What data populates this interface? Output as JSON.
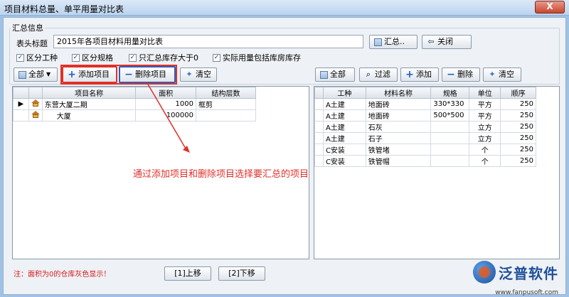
{
  "window": {
    "title": "项目材料总量、单平用量对比表",
    "close_label": "X"
  },
  "summary": {
    "group_label": "汇总信息",
    "header_label": "表头标题",
    "header_value": "2015年各项目材料用量对比表",
    "summarize_button": "汇总..",
    "close_button": "关闭",
    "checkboxes": [
      {
        "label": "区分工种",
        "checked": true
      },
      {
        "label": "区分规格",
        "checked": true
      },
      {
        "label": "只汇总库存大于0",
        "checked": true
      },
      {
        "label": "实际用量包括库房库存",
        "checked": true
      }
    ]
  },
  "left_toolbar": {
    "all": "全部",
    "add": "添加项目",
    "remove": "删除项目",
    "clear": "清空"
  },
  "right_toolbar": {
    "all": "全部",
    "filter": "过滤",
    "add": "添加",
    "remove": "删除",
    "clear": "清空"
  },
  "projects": {
    "columns": [
      "项目名称",
      "面积",
      "结构层数"
    ],
    "rows": [
      {
        "name": "东营大厦二期",
        "area": "1000",
        "structure": "框剪",
        "selected": true
      },
      {
        "name": "大厦",
        "area": "100000",
        "structure": "",
        "selected": false
      }
    ]
  },
  "materials": {
    "columns": [
      "工种",
      "材料名称",
      "规格",
      "单位",
      "顺序"
    ],
    "rows": [
      [
        "A土建",
        "地面砖",
        "330*330",
        "平方",
        "250"
      ],
      [
        "A土建",
        "地面砖",
        "500*500",
        "平方",
        "250"
      ],
      [
        "A土建",
        "石灰",
        "",
        "立方",
        "250"
      ],
      [
        "A土建",
        "石子",
        "",
        "立方",
        "250"
      ],
      [
        "C安装",
        "铁管堵",
        "",
        "个",
        "250"
      ],
      [
        "C安装",
        "铁管帽",
        "",
        "个",
        "250"
      ]
    ]
  },
  "annotation": "通过添加项目和删除项目选择要汇总的项目",
  "footer": {
    "note": "注：面积为0的仓库灰色显示！",
    "up": "[1]上移",
    "down": "[2]下移"
  },
  "logo": {
    "name": "泛普软件",
    "url": "www.fanpusoft.com"
  },
  "colors": {
    "annotation": "#e0302a",
    "note": "#d41e1e"
  }
}
